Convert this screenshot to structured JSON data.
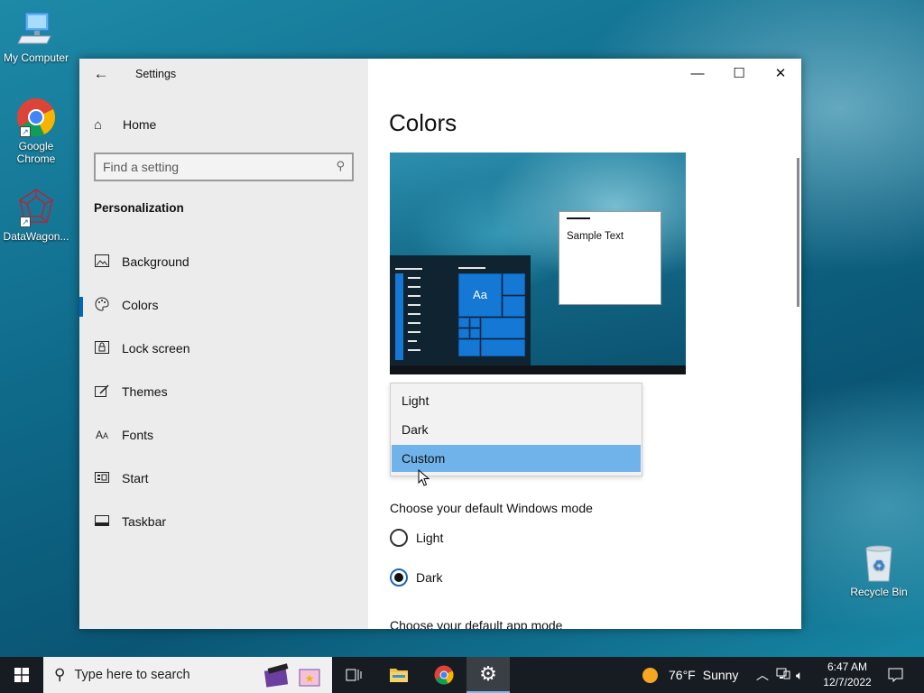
{
  "desktop": {
    "icons": [
      {
        "label": "My Computer"
      },
      {
        "label": "Google Chrome"
      },
      {
        "label": "DataWagon..."
      },
      {
        "label": "Recycle Bin"
      }
    ]
  },
  "window": {
    "title": "Settings",
    "nav": {
      "home_label": "Home",
      "search_placeholder": "Find a setting",
      "section_title": "Personalization",
      "items": [
        {
          "label": "Background",
          "icon": "picture-icon"
        },
        {
          "label": "Colors",
          "icon": "palette-icon",
          "selected": true
        },
        {
          "label": "Lock screen",
          "icon": "lock-screen-icon"
        },
        {
          "label": "Themes",
          "icon": "themes-icon"
        },
        {
          "label": "Fonts",
          "icon": "fonts-icon"
        },
        {
          "label": "Start",
          "icon": "start-icon"
        },
        {
          "label": "Taskbar",
          "icon": "taskbar-icon"
        }
      ]
    },
    "content": {
      "page_title": "Colors",
      "preview": {
        "sample_text": "Sample Text",
        "tile_text": "Aa"
      },
      "color_dropdown": {
        "options": [
          "Light",
          "Dark",
          "Custom"
        ],
        "highlighted": "Custom"
      },
      "windows_mode": {
        "label": "Choose your default Windows mode",
        "options": [
          "Light",
          "Dark"
        ],
        "selected": "Dark"
      },
      "app_mode_label": "Choose your default app mode"
    }
  },
  "taskbar": {
    "search_placeholder": "Type here to search",
    "weather": {
      "temp": "76°F",
      "condition": "Sunny"
    },
    "clock": {
      "time": "6:47 AM",
      "date": "12/7/2022"
    }
  },
  "colors": {
    "accent": "#0067c0",
    "highlight": "#6fb3ea",
    "taskbar": "#171c22"
  }
}
